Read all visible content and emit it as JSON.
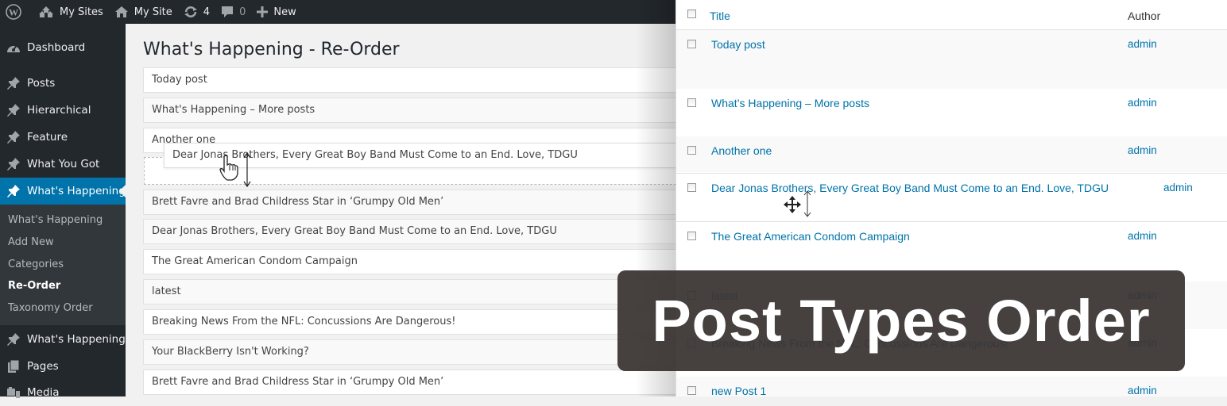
{
  "adminbar": {
    "my_sites": "My Sites",
    "my_site": "My Site",
    "updates_count": "4",
    "comments_count": "0",
    "new_label": "New"
  },
  "sidebar": {
    "items": [
      {
        "label": "Dashboard",
        "icon": "dashboard-icon"
      },
      {
        "label": "Posts",
        "icon": "pin-icon"
      },
      {
        "label": "Hierarchical",
        "icon": "pin-icon"
      },
      {
        "label": "Feature",
        "icon": "pin-icon"
      },
      {
        "label": "What You Got",
        "icon": "pin-icon"
      },
      {
        "label": "What's Happening",
        "icon": "pin-icon",
        "current": true
      },
      {
        "label": "What's Happening",
        "icon": "pin-icon"
      },
      {
        "label": "Pages",
        "icon": "pages-icon"
      },
      {
        "label": "Media",
        "icon": "media-icon"
      }
    ],
    "submenu": [
      {
        "label": "What's Happening"
      },
      {
        "label": "Add New"
      },
      {
        "label": "Categories"
      },
      {
        "label": "Re-Order",
        "active": true
      },
      {
        "label": "Taxonomy Order"
      }
    ]
  },
  "main": {
    "title": "What's Happening - Re-Order",
    "items": [
      "Today post",
      "What's Happening – More posts",
      "Another one",
      "Brett Favre and Brad Childress Star in ‘Grumpy Old Men’",
      "Dear Jonas Brothers, Every Great Boy Band Must Come to an End. Love, TDGU",
      "The Great American Condom Campaign",
      "latest",
      "Breaking News From the NFL: Concussions Are Dangerous!",
      "Your BlackBerry Isn't Working?",
      "Brett Favre and Brad Childress Star in ‘Grumpy Old Men’"
    ],
    "dragging_item": "Dear Jonas Brothers, Every Great Boy Band Must Come to an End. Love, TDGU"
  },
  "list_table": {
    "col_title": "Title",
    "col_author": "Author",
    "rows": [
      {
        "title": "Today post",
        "author": "admin"
      },
      {
        "title": "What’s Happening – More posts",
        "author": "admin"
      },
      {
        "title": "Another one",
        "author": "admin"
      },
      {
        "title": "Dear Jonas Brothers, Every Great Boy Band Must Come to an End. Love, TDGU",
        "author": "admin"
      },
      {
        "title": "The Great American Condom Campaign",
        "author": "admin"
      },
      {
        "title": "latest",
        "author": "admin"
      },
      {
        "title": "Breaking News From the NFL: Concussions Are Dangerous!",
        "author": "admin"
      },
      {
        "title": "new Post 1",
        "author": "admin"
      }
    ]
  },
  "banner": {
    "text": "Post Types Order"
  },
  "colors": {
    "accent": "#0073aa",
    "adminbar_bg": "#23282d",
    "banner_bg": "#3a3433"
  }
}
